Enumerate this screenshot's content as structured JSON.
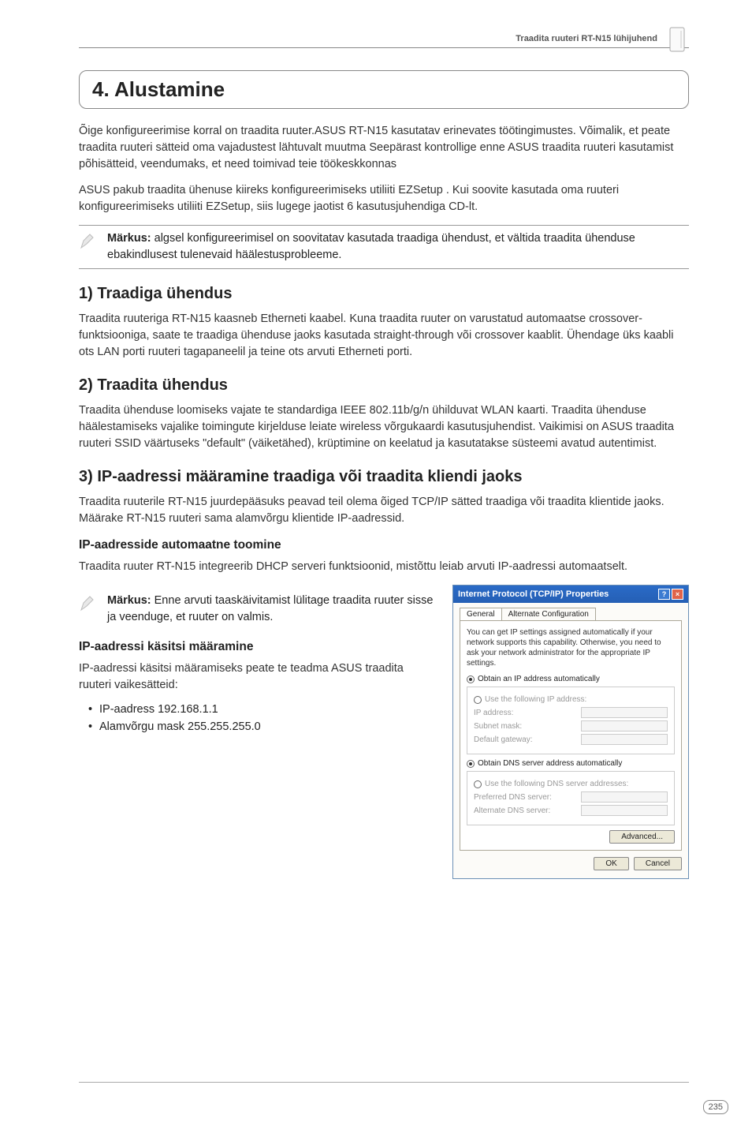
{
  "header": {
    "running_title": "Traadita ruuteri RT-N15 lühijuhend"
  },
  "title": "4. Alustamine",
  "intro_p1": "Õige konfigureerimise korral on traadita ruuter.ASUS RT-N15 kasutatav erinevates töötingimustes. Võimalik, et peate traadita ruuteri sätteid oma vajadustest lähtuvalt muutma Seepärast kontrollige enne ASUS traadita ruuteri kasutamist põhisätteid, veendumaks, et need toimivad teie töökeskkonnas",
  "intro_p2": "ASUS pakub traadita ühenuse kiireks konfigureerimiseks utiliiti EZSetup . Kui soovite kasutada oma ruuteri konfigureerimiseks utiliiti EZSetup, siis lugege jaotist 6 kasutusjuhendiga CD-lt.",
  "note1_label": "Märkus:",
  "note1_text": " algsel konfigureerimisel on soovitatav kasutada traadiga ühendust, et vältida traadita ühenduse ebakindlusest tulenevaid häälestusprobleeme.",
  "h2_1": "1) Traadiga ühendus",
  "p_h2_1": "Traadita ruuteriga RT-N15 kaasneb Etherneti kaabel. Kuna traadita ruuter on varustatud automaatse crossover-funktsiooniga, saate te traadiga ühenduse jaoks kasutada straight-through või crossover kaablit. Ühendage üks kaabli ots LAN porti ruuteri tagapaneelil ja teine ots arvuti Etherneti porti.",
  "h2_2": "2) Traadita ühendus",
  "p_h2_2": "Traadita ühenduse loomiseks vajate te standardiga IEEE 802.11b/g/n ühilduvat WLAN kaarti. Traadita ühenduse häälestamiseks vajalike toimingute kirjelduse leiate wireless võrgukaardi kasutusjuhendist. Vaikimisi on ASUS traadita ruuteri SSID väärtuseks \"default\" (väiketähed), krüptimine on keelatud ja kasutatakse süsteemi avatud autentimist.",
  "h2_3": "3) IP-aadressi määramine traadiga või traadita kliendi jaoks",
  "p_h2_3": "Traadita ruuterile RT-N15 juurdepääsuks peavad teil olema õiged TCP/IP sätted traadiga või traadita klientide jaoks. Määrake RT-N15 ruuteri sama alamvõrgu klientide IP-aadressid.",
  "h3_auto": "IP-aadresside automaatne toomine",
  "p_auto": "Traadita ruuter RT-N15 integreerib DHCP serveri funktsioonid, mistõttu leiab arvuti IP-aadressi automaatselt.",
  "note2_label": "Märkus:",
  "note2_text": " Enne arvuti taaskäivitamist lülitage traadita ruuter sisse ja veenduge, et ruuter on valmis.",
  "h3_manual": "IP-aadressi käsitsi määramine",
  "p_manual": "IP-aadressi käsitsi määramiseks peate te teadma ASUS traadita ruuteri vaikesätteid:",
  "bullets": [
    "IP-aadress 192.168.1.1",
    "Alamvõrgu mask 255.255.255.0"
  ],
  "dialog": {
    "title": "Internet Protocol (TCP/IP) Properties",
    "tabs": {
      "general": "General",
      "alt": "Alternate Configuration"
    },
    "desc": "You can get IP settings assigned automatically if your network supports this capability. Otherwise, you need to ask your network administrator for the appropriate IP settings.",
    "r_obtain_ip": "Obtain an IP address automatically",
    "r_use_ip": "Use the following IP address:",
    "f_ip": "IP address:",
    "f_mask": "Subnet mask:",
    "f_gw": "Default gateway:",
    "r_obtain_dns": "Obtain DNS server address automatically",
    "r_use_dns": "Use the following DNS server addresses:",
    "f_pdns": "Preferred DNS server:",
    "f_adns": "Alternate DNS server:",
    "btn_adv": "Advanced...",
    "btn_ok": "OK",
    "btn_cancel": "Cancel"
  },
  "page_number": "235"
}
